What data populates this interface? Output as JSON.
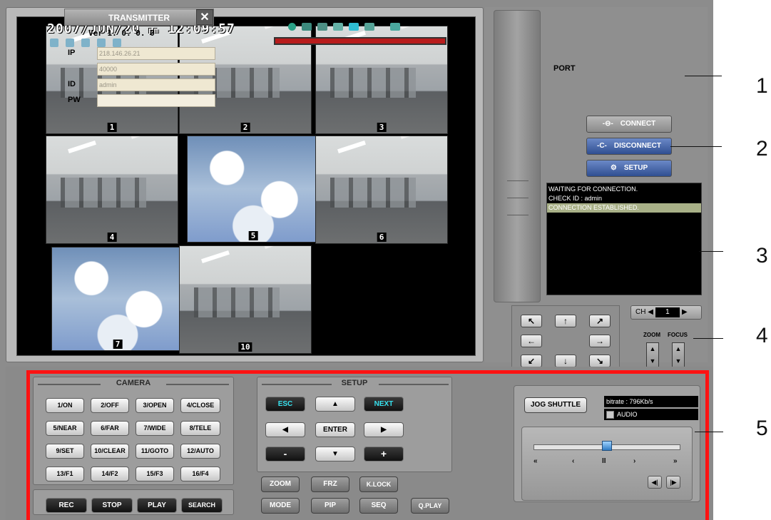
{
  "video": {
    "osd_date": "2007/JUN/20",
    "osd_pm": "pm",
    "osd_time": "12:09:57",
    "tiles": [
      {
        "label": "1",
        "kind": "office"
      },
      {
        "label": "2",
        "kind": "office"
      },
      {
        "label": "3",
        "kind": "office"
      },
      {
        "label": "4",
        "kind": "office"
      },
      {
        "label": "5",
        "kind": "sky"
      },
      {
        "label": "6",
        "kind": "office"
      },
      {
        "label": "7",
        "kind": "sky"
      },
      {
        "label": "10",
        "kind": "office"
      }
    ],
    "recording_bar_color": "#b81c1c"
  },
  "transmitter": {
    "title": "TRANSMITTER",
    "close": "✕",
    "version": "Ver 1. 0. 0. 0",
    "ip_label": "IP",
    "ip_value": "218.146.26.21",
    "port_label": "PORT",
    "port_value": "40000",
    "id_label": "ID",
    "id_value": "admin",
    "pw_label": "PW",
    "pw_value": "",
    "connect": "CONNECT",
    "disconnect": "DISCONNECT",
    "setup": "SETUP"
  },
  "log": {
    "lines": [
      "WAITING FOR CONNECTION.",
      "CHECK ID : admin",
      "CONNECTION ESTABLISHED."
    ]
  },
  "ptz": {
    "up_left": "↖",
    "up": "↑",
    "up_right": "↗",
    "left": "←",
    "right": "→",
    "down_left": "↙",
    "down": "↓",
    "down_right": "↘"
  },
  "channel": {
    "label": "CH",
    "value": "1",
    "zoom_label": "ZOOM",
    "focus_label": "FOCUS"
  },
  "camera": {
    "title": "CAMERA",
    "buttons": [
      "1/ON",
      "2/OFF",
      "3/OPEN",
      "4/CLOSE",
      "5/NEAR",
      "6/FAR",
      "7/WIDE",
      "8/TELE",
      "9/SET",
      "10/CLEAR",
      "11/GOTO",
      "12/AUTO",
      "13/F1",
      "14/F2",
      "15/F3",
      "16/F4"
    ]
  },
  "record": {
    "buttons": [
      "REC",
      "STOP",
      "PLAY",
      "SEARCH"
    ]
  },
  "setup": {
    "title": "SETUP",
    "esc": "ESC",
    "up": "▲",
    "next": "NEXT",
    "left": "◀",
    "enter": "ENTER",
    "right": "▶",
    "minus": "-",
    "down": "▼",
    "plus": "+"
  },
  "function_buttons": [
    "ZOOM",
    "FRZ",
    "K.LOCK",
    "MODE",
    "PIP",
    "SEQ",
    "Q.PLAY"
  ],
  "jog": {
    "button": "JOG SHUTTLE",
    "bitrate": "bitrate : 796Kb/s",
    "audio": "AUDIO",
    "position": 0.5,
    "controls": [
      "«",
      "‹",
      "II",
      "›",
      "»"
    ],
    "step_back": "◀|",
    "step_fwd": "|▶"
  },
  "callouts": [
    "1",
    "2",
    "3",
    "4",
    "5"
  ],
  "colors": {
    "highlight_frame": "#ff1212",
    "log_highlight": "#a8b087",
    "cyan_text": "#36e1ee"
  }
}
